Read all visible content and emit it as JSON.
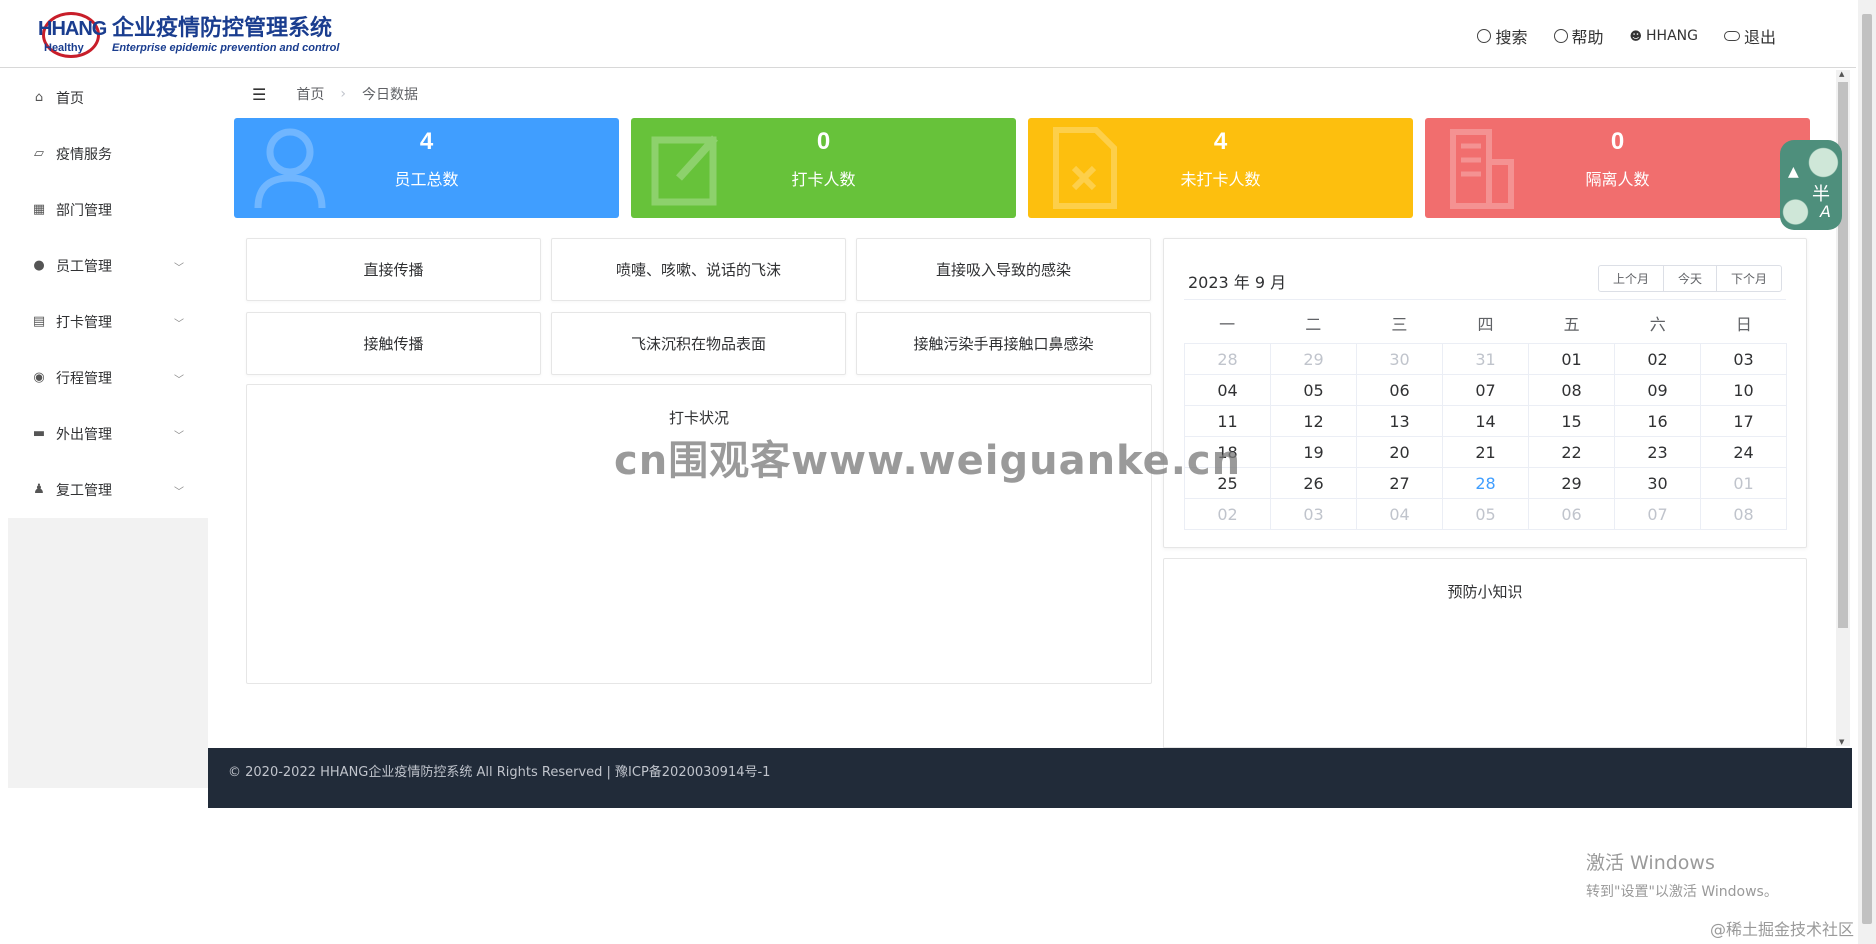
{
  "header": {
    "logo_mark_top": "HHANG",
    "logo_mark_bottom": "Healthy",
    "logo_cn": "企业疫情防控管理系统",
    "logo_en": "Enterprise epidemic prevention and control",
    "search": "搜索",
    "help": "帮助",
    "user": "HHANG",
    "logout": "退出"
  },
  "sidebar": {
    "items": [
      {
        "label": "首页",
        "icon": "home-icon"
      },
      {
        "label": "疫情服务",
        "icon": "chart-icon"
      },
      {
        "label": "部门管理",
        "icon": "grid-icon"
      },
      {
        "label": "员工管理",
        "icon": "user-icon",
        "expandable": true
      },
      {
        "label": "打卡管理",
        "icon": "clipboard-icon",
        "expandable": true
      },
      {
        "label": "行程管理",
        "icon": "location-icon",
        "expandable": true
      },
      {
        "label": "外出管理",
        "icon": "briefcase-icon",
        "expandable": true
      },
      {
        "label": "复工管理",
        "icon": "worker-icon",
        "expandable": true
      }
    ]
  },
  "breadcrumb": [
    "首页",
    "今日数据"
  ],
  "cards": [
    {
      "value": "4",
      "label": "员工总数",
      "color": "#409eff"
    },
    {
      "value": "0",
      "label": "打卡人数",
      "color": "#67c23a"
    },
    {
      "value": "4",
      "label": "未打卡人数",
      "color": "#fdbf0e"
    },
    {
      "value": "0",
      "label": "隔离人数",
      "color": "#f16e6e"
    }
  ],
  "tips": [
    [
      "直接传播",
      "喷嚏、咳嗽、说话的飞沫",
      "直接吸入导致的感染"
    ],
    [
      "接触传播",
      "飞沫沉积在物品表面",
      "接触污染手再接触口鼻感染"
    ]
  ],
  "chart_panel": {
    "title": "打卡状况"
  },
  "calendar": {
    "title": "2023 年 9 月",
    "buttons": [
      "上个月",
      "今天",
      "下个月"
    ],
    "weekdays": [
      "一",
      "二",
      "三",
      "四",
      "五",
      "六",
      "日"
    ],
    "days": [
      "28",
      "29",
      "30",
      "31",
      "01",
      "02",
      "03",
      "04",
      "05",
      "06",
      "07",
      "08",
      "09",
      "10",
      "11",
      "12",
      "13",
      "14",
      "15",
      "16",
      "17",
      "18",
      "19",
      "20",
      "21",
      "22",
      "23",
      "24",
      "25",
      "26",
      "27",
      "28",
      "29",
      "30",
      "01",
      "02",
      "03",
      "04",
      "05",
      "06",
      "07",
      "08"
    ],
    "muted_indexes": [
      0,
      1,
      2,
      3,
      34,
      35,
      36,
      37,
      38,
      39,
      40,
      41
    ],
    "today_index": 31
  },
  "knowledge_panel": {
    "title": "预防小知识"
  },
  "footer": {
    "text": "© 2020-2022 HHANG企业疫情防控系统 All Rights Reserved | 豫ICP备2020030914号-1"
  },
  "floating_badge": {
    "char1": "半",
    "char2": "A"
  },
  "overlays": {
    "watermark": "cn围观客www.weiguanke.cn",
    "windows_line1": "激活 Windows",
    "windows_line2": "转到\"设置\"以激活 Windows。",
    "juejin": "@稀土掘金技术社区"
  }
}
